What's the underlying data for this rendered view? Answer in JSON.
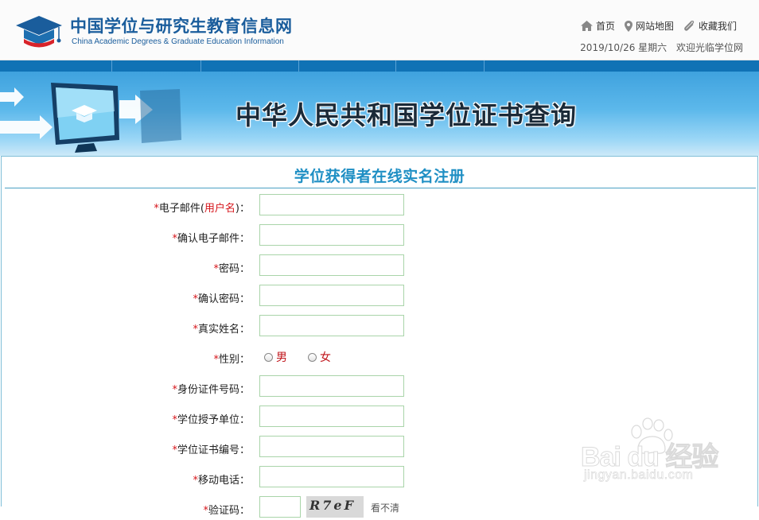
{
  "site": {
    "title_cn": "中国学位与研究生教育信息网",
    "title_en": "China Academic Degrees & Graduate Education Information"
  },
  "topnav": {
    "home": "首页",
    "sitemap": "网站地图",
    "favorite": "收藏我们"
  },
  "greeting": {
    "date": "2019/10/26 星期六",
    "welcome": "欢迎光临学位网"
  },
  "banner": {
    "title": "中华人民共和国学位证书查询"
  },
  "form": {
    "title": "学位获得者在线实名注册",
    "required_mark": "*",
    "fields": [
      {
        "label": "电子邮件(",
        "label_red": "用户名",
        "label_end": ")：",
        "value": ""
      },
      {
        "label": "确认电子邮件：",
        "value": ""
      },
      {
        "label": "密码：",
        "value": ""
      },
      {
        "label": "确认密码：",
        "value": ""
      },
      {
        "label": "真实姓名：",
        "value": ""
      },
      {
        "label": "性别：",
        "options": [
          "男",
          "女"
        ]
      },
      {
        "label": "身份证件号码：",
        "value": ""
      },
      {
        "label": "学位授予单位：",
        "value": ""
      },
      {
        "label": "学位证书编号：",
        "value": ""
      },
      {
        "label": "移动电话：",
        "value": ""
      },
      {
        "label": "验证码：",
        "value": "",
        "captcha_text": "R7eF",
        "refresh": "看不清"
      }
    ]
  },
  "watermark": {
    "brand": "Bai du 经验",
    "url": "jingyan.baidu.com"
  },
  "colors": {
    "brand_blue": "#1a5d9c",
    "bar_blue": "#1072b5",
    "title_blue": "#1f8fc4",
    "required_red": "#d6141a",
    "input_border": "#a9d4a9"
  },
  "icons": [
    "graduation-cap-logo",
    "home-icon",
    "map-pin-icon",
    "paperclip-icon",
    "monitor-graduation-icon",
    "arrow-icon",
    "baidu-paw-icon"
  ]
}
